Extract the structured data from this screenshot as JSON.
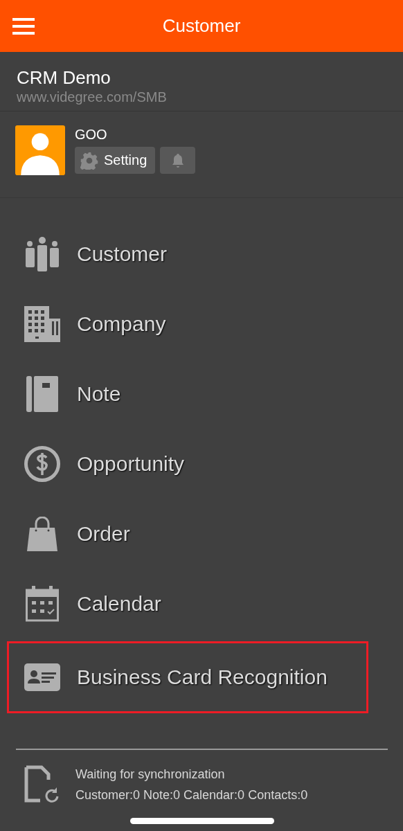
{
  "header": {
    "title": "Customer"
  },
  "account": {
    "name": "CRM Demo",
    "url": "www.videgree.com/SMB"
  },
  "user": {
    "name": "GOO",
    "setting_button": "Setting"
  },
  "menu": [
    {
      "kind": "customer",
      "label": "Customer",
      "highlighted": false
    },
    {
      "kind": "company",
      "label": "Company",
      "highlighted": false
    },
    {
      "kind": "note",
      "label": "Note",
      "highlighted": false
    },
    {
      "kind": "opportunity",
      "label": "Opportunity",
      "highlighted": false
    },
    {
      "kind": "order",
      "label": "Order",
      "highlighted": false
    },
    {
      "kind": "calendar",
      "label": "Calendar",
      "highlighted": false
    },
    {
      "kind": "card",
      "label": "Business Card Recognition",
      "highlighted": true
    }
  ],
  "sync": {
    "status": "Waiting for synchronization",
    "counts": "Customer:0 Note:0 Calendar:0 Contacts:0"
  }
}
